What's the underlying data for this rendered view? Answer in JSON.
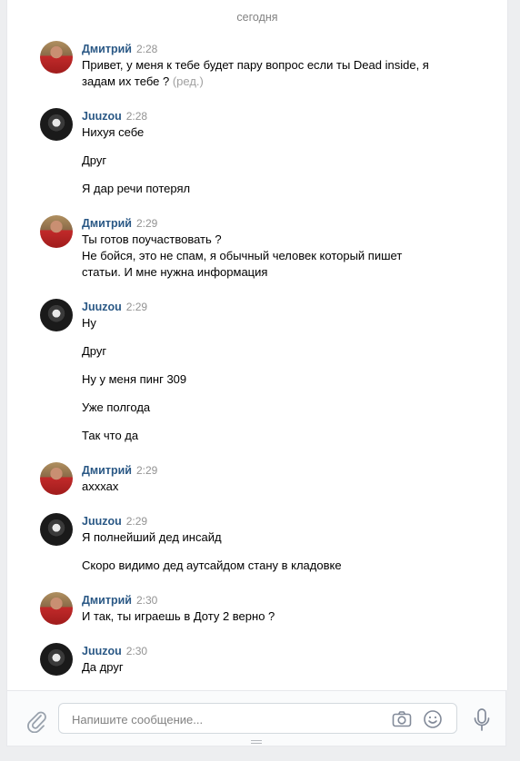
{
  "chat": {
    "date_separator": "сегодня"
  },
  "messages": [
    {
      "author": "Дмитрий",
      "time": "2:28",
      "lines": [
        "Привет, у меня к тебе будет пару вопрос если ты Dead inside, я",
        "задам их тебе ?"
      ],
      "edited": "(ред.)"
    },
    {
      "author": "Juuzou",
      "time": "2:28",
      "lines": [
        "Нихуя себе",
        "Друг",
        "Я дар речи потерял"
      ]
    },
    {
      "author": "Дмитрий",
      "time": "2:29",
      "lines": [
        "Ты готов поучаствовать ?",
        "Не бойся, это не спам, я обычный человек который пишет",
        "статьи. И мне нужна информация"
      ]
    },
    {
      "author": "Juuzou",
      "time": "2:29",
      "lines": [
        "Ну",
        "Друг",
        "Ну у меня пинг 309",
        "Уже полгода",
        "Так что да"
      ]
    },
    {
      "author": "Дмитрий",
      "time": "2:29",
      "lines": [
        "ахххах"
      ]
    },
    {
      "author": "Juuzou",
      "time": "2:29",
      "lines": [
        "Я полнейший дед инсайд",
        "Скоро видимо дед аутсайдом стану в кладовке"
      ]
    },
    {
      "author": "Дмитрий",
      "time": "2:30",
      "lines": [
        "И так, ты играешь в Доту 2 верно ?"
      ]
    },
    {
      "author": "Juuzou",
      "time": "2:30",
      "lines": [
        "Да друг"
      ]
    }
  ],
  "composer": {
    "placeholder": "Напишите сообщение..."
  },
  "icons": {
    "attach": "paperclip-icon",
    "camera": "camera-icon",
    "emoji": "smile-icon",
    "voice": "microphone-icon"
  },
  "colors": {
    "author": "#2a5885",
    "time": "#939393",
    "background": "#edeef0"
  }
}
